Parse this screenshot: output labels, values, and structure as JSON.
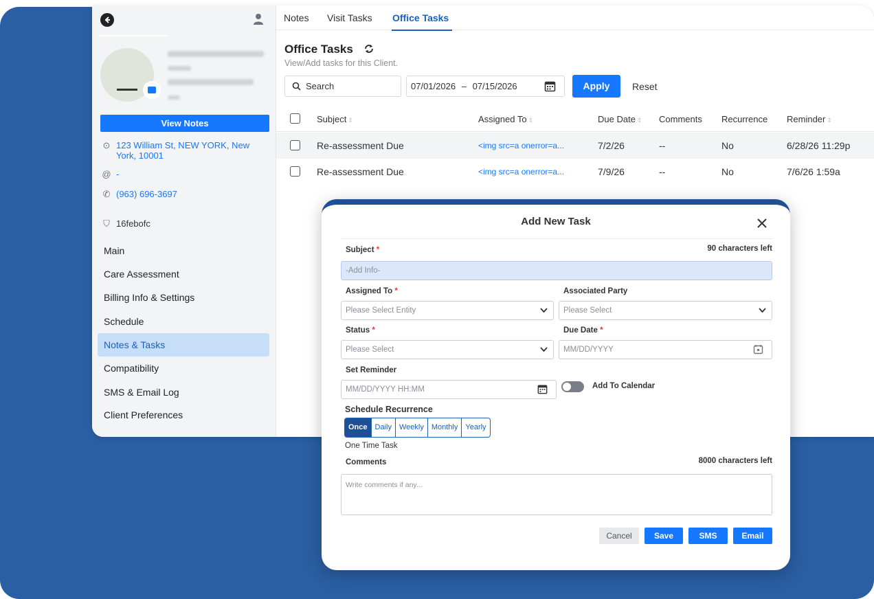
{
  "sidebar": {
    "view_notes_label": "View Notes",
    "address": "123 William St, NEW YORK, New York, 10001",
    "email": "-",
    "phone": "(963) 696-3697",
    "code": "16febofc",
    "nav": [
      "Main",
      "Care Assessment",
      "Billing Info & Settings",
      "Schedule",
      "Notes & Tasks",
      "Compatibility",
      "SMS & Email Log",
      "Client Preferences"
    ],
    "active_nav": "Notes & Tasks"
  },
  "tabs": [
    "Notes",
    "Visit Tasks",
    "Office Tasks"
  ],
  "active_tab": "Office Tasks",
  "page": {
    "title": "Office Tasks",
    "subtitle": "View/Add tasks for this Client.",
    "search_placeholder": "Search",
    "date_from": "07/01/2026",
    "date_sep": "–",
    "date_to": "07/15/2026",
    "apply_label": "Apply",
    "reset_label": "Reset"
  },
  "table": {
    "columns": [
      "Subject",
      "Assigned To",
      "Due Date",
      "Comments",
      "Recurrence",
      "Reminder"
    ],
    "rows": [
      {
        "subject": "Re-assessment Due",
        "assigned": "<img src=a onerror=a...",
        "due": "7/2/26",
        "comments": "--",
        "recurrence": "No",
        "reminder": "6/28/26 11:29p"
      },
      {
        "subject": "Re-assessment Due",
        "assigned": "<img src=a onerror=a...",
        "due": "7/9/26",
        "comments": "--",
        "recurrence": "No",
        "reminder": "7/6/26 1:59a"
      }
    ]
  },
  "modal": {
    "title": "Add New Task",
    "subject_label": "Subject",
    "subject_hint": "90 characters left",
    "subject_placeholder": "-Add Info-",
    "assigned_label": "Assigned To",
    "assigned_placeholder": "Please Select Entity",
    "party_label": "Associated Party",
    "party_placeholder": "Please Select",
    "status_label": "Status",
    "status_placeholder": "Please Select",
    "due_label": "Due Date",
    "due_placeholder": "MM/DD/YYYY",
    "reminder_label": "Set Reminder",
    "reminder_placeholder": "MM/DD/YYYY HH:MM",
    "calendar_toggle_label": "Add To Calendar",
    "recurrence_label": "Schedule Recurrence",
    "recurrence_options": [
      "Once",
      "Daily",
      "Weekly",
      "Monthly",
      "Yearly"
    ],
    "recurrence_selected": "Once",
    "recurrence_note": "One Time Task",
    "comments_label": "Comments",
    "comments_hint": "8000 characters left",
    "comments_placeholder": "Write comments if any...",
    "buttons": {
      "cancel": "Cancel",
      "save": "Save",
      "sms": "SMS",
      "email": "Email"
    }
  },
  "colors": {
    "accent": "#1677ff",
    "brand_dark": "#1f4f94",
    "background": "#2a5fa3",
    "active_nav": "#c7def8"
  }
}
